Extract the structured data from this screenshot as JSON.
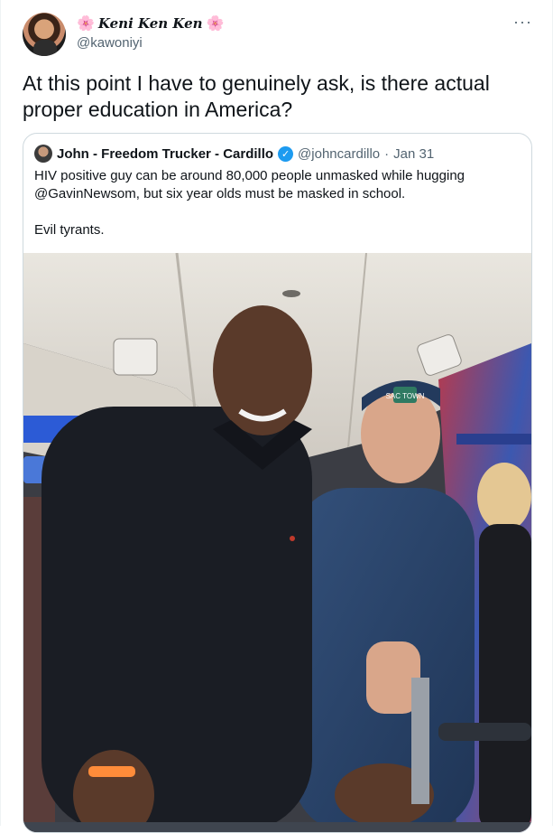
{
  "tweet": {
    "author": {
      "display_name": "Keni Ken Ken",
      "handle": "@kawoniyi",
      "flower_glyph": "🌸"
    },
    "more_label": "···",
    "text": "At this point I have to genuinely ask, is there actual proper education in America?"
  },
  "quote": {
    "author": {
      "display_name": "John - Freedom Trucker - Cardillo",
      "handle": "@johncardillo",
      "date": "Jan 31",
      "separator": "·"
    },
    "text_line1": "HIV positive guy can be around 80,000 people unmasked while hugging @GavinNewsom, but six year olds must be masked in school.",
    "text_line2": "Evil tyrants.",
    "photo": {
      "cap_logo_text": "SAC TOWN"
    }
  },
  "colors": {
    "link_blue": "#1d9bf0",
    "secondary_text": "#536471",
    "border": "#cfd9de"
  },
  "icons": [
    "flower-emoji-icon",
    "verified-badge-icon",
    "more-options-icon"
  ]
}
